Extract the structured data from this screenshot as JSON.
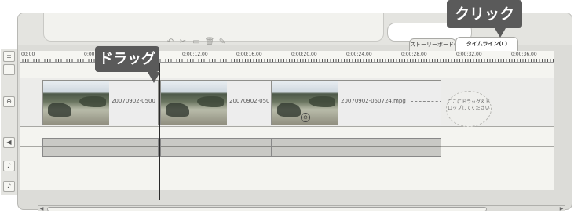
{
  "callouts": {
    "drag": "ドラッグ",
    "click": "クリック"
  },
  "tabs": {
    "storyboard": "ストーリーボード(S)",
    "timeline": "タイムライン(L)"
  },
  "ruler": {
    "labels": [
      "00:00",
      "0:00",
      "0:00:12.00",
      "0:00:16.00",
      "0:00:20.00",
      "0:00:24.00",
      "0:00:28.00",
      "0:00:32.00",
      "0:00:36.00"
    ]
  },
  "left_toolbar": {
    "title_label": "T"
  },
  "clips": [
    {
      "name": "20070902-0500"
    },
    {
      "name": "20070902-050"
    },
    {
      "name": "20070902-050724.mpg"
    }
  ],
  "dropzone": {
    "text": "ここにドラッグ＆ドロップしてください"
  },
  "icons": {
    "tools": [
      "undo-icon",
      "scissors-icon",
      "split-icon",
      "trash-icon",
      "pencil-icon"
    ],
    "left": [
      "zoom-icon",
      "title-track-icon",
      "video-track-icon",
      "voice-track-icon",
      "music-track-1-icon",
      "music-track-2-icon"
    ]
  }
}
